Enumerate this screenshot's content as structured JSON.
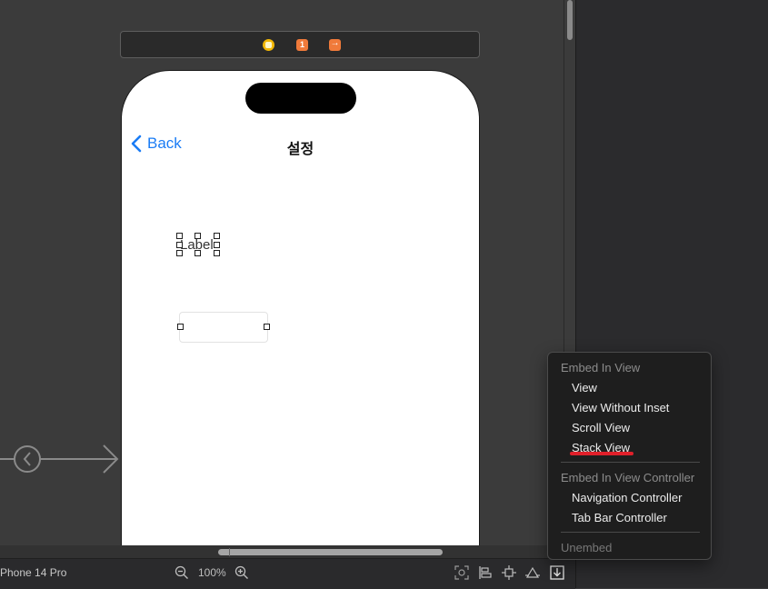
{
  "scene_dock": {
    "icons": [
      "view-controller-icon",
      "first-responder-icon",
      "exit-icon"
    ],
    "first_responder_glyph": "1"
  },
  "phone": {
    "nav": {
      "back_label": "Back",
      "title": "설정"
    },
    "label_text": "Label"
  },
  "menu": {
    "sections": [
      {
        "header": "Embed In View",
        "items": [
          "View",
          "View Without Inset",
          "Scroll View",
          "Stack View"
        ]
      },
      {
        "header": "Embed In View Controller",
        "items": [
          "Navigation Controller",
          "Tab Bar Controller"
        ]
      }
    ],
    "unembed_label": "Unembed",
    "highlighted_item": "Stack View",
    "highlight_color": "#e0202a"
  },
  "bottom_bar": {
    "device_name": "Phone 14 Pro",
    "zoom_level": "100%"
  },
  "colors": {
    "accent": "#1a7cf5",
    "canvas": "#3b3b3b"
  }
}
